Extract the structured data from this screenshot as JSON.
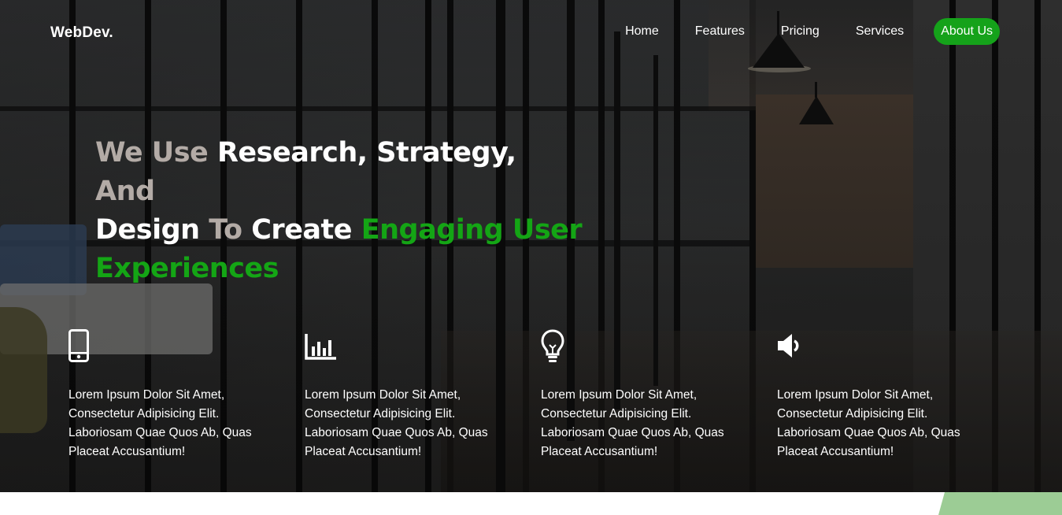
{
  "brand": {
    "logo": "WebDev."
  },
  "nav": {
    "items": [
      "Home",
      "Features",
      "Pricing",
      "Services"
    ],
    "cta": "About Us",
    "cta_color": "#15a21a"
  },
  "hero": {
    "headline": {
      "w1": "We Use ",
      "w2": "Research, Strategy, ",
      "w3": "And",
      "w4": "Design ",
      "w5": "To ",
      "w6": "Create ",
      "w7": "Engaging User",
      "w8": "Experiences"
    },
    "accent_color": "#14a515",
    "features": [
      {
        "icon": "mobile-phone-icon",
        "text": "Lorem Ipsum Dolor Sit Amet, Consectetur Adipisicing Elit. Laboriosam Quae Quos Ab, Quas Placeat Accusantium!"
      },
      {
        "icon": "bar-chart-icon",
        "text": "Lorem Ipsum Dolor Sit Amet, Consectetur Adipisicing Elit. Laboriosam Quae Quos Ab, Quas Placeat Accusantium!"
      },
      {
        "icon": "lightbulb-icon",
        "text": "Lorem Ipsum Dolor Sit Amet, Consectetur Adipisicing Elit. Laboriosam Quae Quos Ab, Quas Placeat Accusantium!"
      },
      {
        "icon": "speaker-icon",
        "text": "Lorem Ipsum Dolor Sit Amet, Consectetur Adipisicing Elit. Laboriosam Quae Quos Ab, Quas Placeat Accusantium!"
      }
    ]
  }
}
